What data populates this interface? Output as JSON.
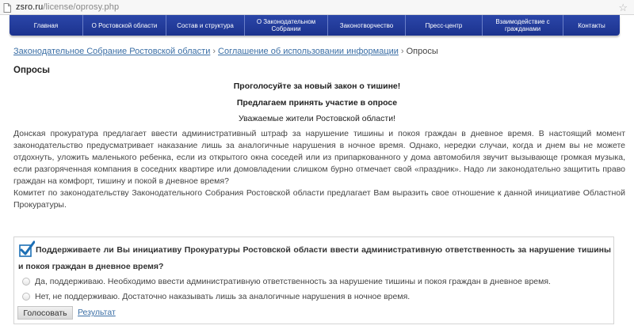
{
  "browser": {
    "url_host": "zsro.ru",
    "url_path": "/license/oprosy.php"
  },
  "nav": {
    "items": [
      "Главная",
      "О Ростовской области",
      "Состав и структура",
      "О Законодательном Собрании",
      "Законотворчество",
      "Пресс-центр",
      "Взаимодействие с гражданами",
      "Контакты"
    ]
  },
  "breadcrumb": {
    "items": [
      "Законодательное Собрание Ростовской области",
      "Соглашение об использовании информации",
      "Опросы"
    ],
    "separator": "›"
  },
  "page": {
    "title": "Опросы",
    "headline": "Проголосуйте за новый закон о тишине!",
    "invite": "Предлагаем принять участие в опросе",
    "greeting": "Уважаемые жители Ростовской области!",
    "paragraph1": "Донская прокуратура предлагает ввести административный штраф за нарушение тишины и покоя граждан в дневное время. В настоящий момент законодательство предусматривает наказание лишь за аналогичные нарушения в ночное время. Однако, нередки случаи, когда и днем вы не можете отдохнуть, уложить маленького ребенка, если из открытого окна соседей или из припаркованного у дома автомобиля звучит вызывающе громкая музыка, если разгоряченная компания в соседних квартире или домовладении слишком бурно отмечает свой «праздник». Надо ли законодательно защитить право граждан на комфорт, тишину и покой  в дневное время?",
    "paragraph2": "Комитет по законодательству Законодательного Собрания Ростовской области предлагает Вам выразить свое отношение к данной инициативе Областной Прокуратуры."
  },
  "poll": {
    "question": "Поддерживаете ли Вы инициативу Прокуратуры Ростовской области ввести административную ответственность за нарушение тишины и покоя граждан в дневное время?",
    "options": [
      "Да, поддерживаю. Необходимо ввести административную ответственность за нарушение тишины и покоя граждан в дневное время.",
      "Нет, не поддерживаю. Достаточно наказывать лишь за аналогичные нарушения в ночное время."
    ],
    "vote_label": "Голосовать",
    "results_label": "Результат"
  },
  "colors": {
    "nav_bg": "#1f3797",
    "link": "#3a6ea5",
    "check": "#1c6fb5"
  }
}
